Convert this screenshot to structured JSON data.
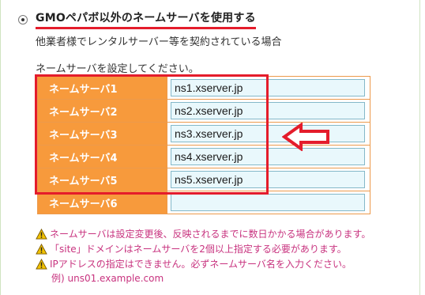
{
  "option": {
    "heading": "GMOペパボ以外のネームサーバを使用する",
    "subtext": "他業者様でレンタルサーバー等を契約されている場合"
  },
  "instruction": "ネームサーバを設定してください。",
  "nameservers": [
    {
      "label": "ネームサーバ1",
      "value": "ns1.xserver.jp"
    },
    {
      "label": "ネームサーバ2",
      "value": "ns2.xserver.jp"
    },
    {
      "label": "ネームサーバ3",
      "value": "ns3.xserver.jp"
    },
    {
      "label": "ネームサーバ4",
      "value": "ns4.xserver.jp"
    },
    {
      "label": "ネームサーバ5",
      "value": "ns5.xserver.jp"
    },
    {
      "label": "ネームサーバ6",
      "value": ""
    }
  ],
  "notes": [
    "ネームサーバは設定変更後、反映されるまでに数日かかる場合があります。",
    "「site」ドメインはネームサーバを2個以上指定する必要があります。",
    "IPアドレスの指定はできません。必ずネームサーバ名を入力ください。"
  ],
  "example": "例) uns01.example.com",
  "colors": {
    "highlight": "#e41c2b",
    "label_bg": "#f79a3c",
    "note_text": "#c8337f",
    "input_bg": "#e9f8fc"
  },
  "icons": {
    "radio": "radio-selected-icon",
    "arrow": "left-arrow-icon",
    "warning": "warning-icon"
  }
}
